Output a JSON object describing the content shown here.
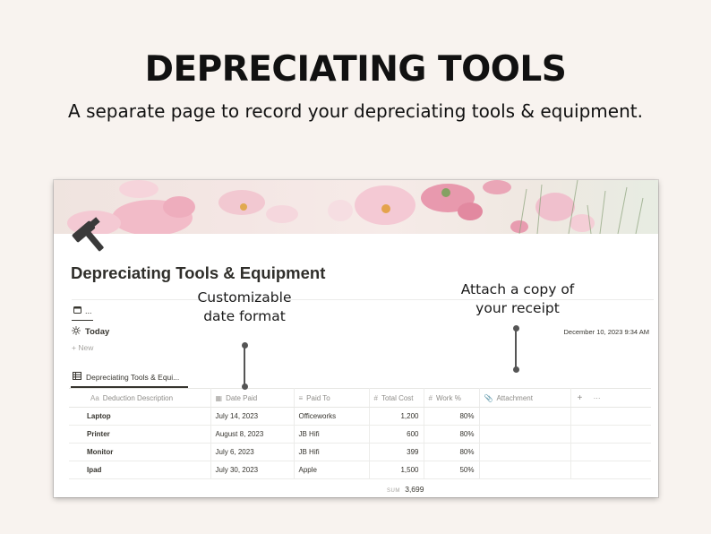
{
  "headline": "DEPRECIATING TOOLS",
  "subhead": "A separate page to record your depreciating tools & equipment.",
  "page": {
    "cover_image": "pink-cosmos-flowers",
    "icon": "hammer-icon",
    "title": "Depreciating Tools & Equipment",
    "property_label": "...",
    "today_label": "Today",
    "timestamp": "December 10, 2023 9:34 AM",
    "new_label": "New",
    "db_tab_label": "Depreciating Tools & Equi..."
  },
  "annotations": {
    "date_format": [
      "Customizable",
      "date format"
    ],
    "receipt": [
      "Attach a copy of",
      "your receipt"
    ]
  },
  "table": {
    "columns": [
      {
        "label": "Deduction Description",
        "icon": "Aa"
      },
      {
        "label": "Date Paid",
        "icon": "calendar-icon"
      },
      {
        "label": "Paid To",
        "icon": "text-icon"
      },
      {
        "label": "Total Cost",
        "icon": "#"
      },
      {
        "label": "Work %",
        "icon": "#"
      },
      {
        "label": "Attachment",
        "icon": "paperclip-icon"
      }
    ],
    "rows": [
      {
        "name": "Laptop",
        "date": "July 14, 2023",
        "paid_to": "Officeworks",
        "cost": "1,200",
        "work": "80%"
      },
      {
        "name": "Printer",
        "date": "August 8, 2023",
        "paid_to": "JB Hifi",
        "cost": "600",
        "work": "80%"
      },
      {
        "name": "Monitor",
        "date": "July 6, 2023",
        "paid_to": "JB Hifi",
        "cost": "399",
        "work": "80%"
      },
      {
        "name": "Ipad",
        "date": "July 30, 2023",
        "paid_to": "Apple",
        "cost": "1,500",
        "work": "50%"
      }
    ],
    "sum_label": "SUM",
    "sum_value": "3,699",
    "add_column": "+",
    "more": "···"
  }
}
